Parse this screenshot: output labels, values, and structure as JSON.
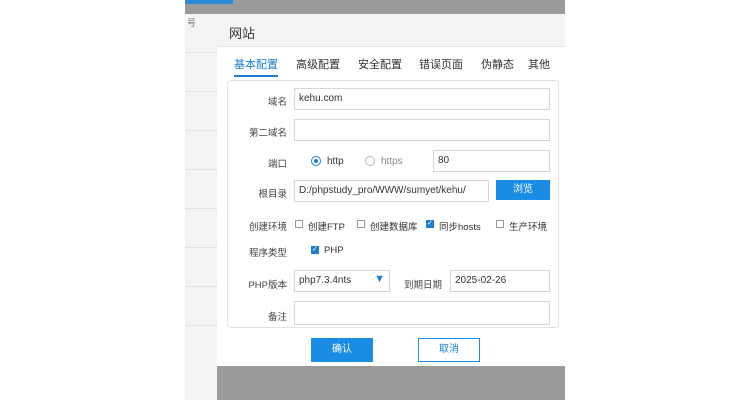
{
  "background": {
    "list_header": "号"
  },
  "dialog": {
    "title": "网站",
    "tabs": [
      "基本配置",
      "高级配置",
      "安全配置",
      "错误页面",
      "伪静态",
      "其他"
    ],
    "active_tab": 0
  },
  "form": {
    "domain": {
      "label": "域名",
      "value": "kehu.com"
    },
    "second_domain": {
      "label": "第二域名",
      "value": ""
    },
    "port": {
      "label": "端口",
      "http_label": "http",
      "https_label": "https",
      "selected": "http",
      "value": "80"
    },
    "root_dir": {
      "label": "根目录",
      "value": "D:/phpstudy_pro/WWW/sumyet/kehu/",
      "browse_label": "浏览"
    },
    "create_env": {
      "label": "创建环境",
      "options": [
        {
          "label": "创建FTP",
          "checked": false
        },
        {
          "label": "创建数据库",
          "checked": false
        },
        {
          "label": "同步hosts",
          "checked": true
        },
        {
          "label": "生产环境",
          "checked": false
        }
      ]
    },
    "program_type": {
      "label": "程序类型",
      "option": "PHP",
      "checked": true
    },
    "php_version": {
      "label": "PHP版本",
      "value": "php7.3.4nts"
    },
    "expire_date": {
      "label": "到期日期",
      "value": "2025-02-26"
    },
    "remark": {
      "label": "备注",
      "value": ""
    }
  },
  "buttons": {
    "confirm": "确认",
    "cancel": "取消"
  },
  "colors": {
    "accent": "#1a8ce3",
    "overlay": "#9a9a9a"
  }
}
